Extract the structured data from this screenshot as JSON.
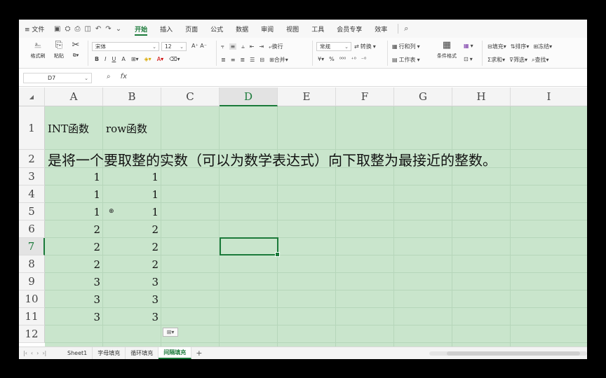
{
  "menubar": {
    "file_label": "≡ 文件",
    "tabs": [
      {
        "label": "开始",
        "active": true
      },
      {
        "label": "插入"
      },
      {
        "label": "页面"
      },
      {
        "label": "公式"
      },
      {
        "label": "数据"
      },
      {
        "label": "审阅"
      },
      {
        "label": "视图"
      },
      {
        "label": "工具"
      },
      {
        "label": "会员专享"
      },
      {
        "label": "效率"
      }
    ]
  },
  "ribbon": {
    "paste_label": "格式刷",
    "paste2_label": "粘贴",
    "font_name": "宋体",
    "font_size": "12",
    "wrap_label": "换行",
    "merge_label": "合并",
    "number_format": "常规",
    "convert_label": "转换",
    "rowcol_label": "行和列",
    "worksheet_label": "工作表",
    "cond_format_label": "条件格式",
    "fill_label": "填充",
    "sort_label": "排序",
    "freeze_label": "冻结",
    "sum_label": "求和",
    "filter_label": "筛选",
    "find_label": "查找"
  },
  "formula_bar": {
    "name_box": "D7",
    "fx_label": "fx"
  },
  "grid": {
    "columns": [
      "A",
      "B",
      "C",
      "D",
      "E",
      "F",
      "G",
      "H",
      "I"
    ],
    "rows": [
      "1",
      "2",
      "3",
      "4",
      "5",
      "6",
      "7",
      "8",
      "9",
      "10",
      "11",
      "12"
    ],
    "selected_column": "D",
    "selected_row": "7",
    "a1": "INT函数",
    "b1": "row函数",
    "a2": "是将一个要取整的实数（可以为数学表达式）向下取整为最接近的整数。",
    "col_a_values": [
      "1",
      "1",
      "1",
      "2",
      "2",
      "2",
      "3",
      "3",
      "3"
    ],
    "col_b_values": [
      "1",
      "1",
      "1",
      "2",
      "2",
      "2",
      "3",
      "3",
      "3"
    ]
  },
  "sheets": {
    "tabs": [
      {
        "label": "Sheet1"
      },
      {
        "label": "字母填充"
      },
      {
        "label": "循环填充"
      },
      {
        "label": "间隔填充",
        "active": true
      }
    ],
    "add_label": "+"
  },
  "colors": {
    "accent": "#1b7a3a",
    "cell_fill": "#c9e5cc"
  }
}
